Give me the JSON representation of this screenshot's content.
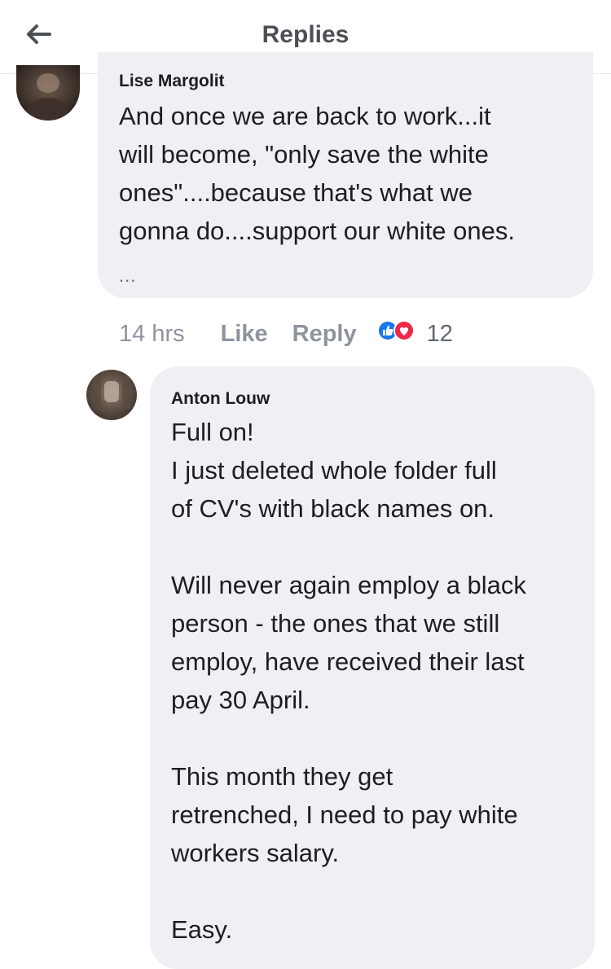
{
  "header": {
    "title": "Replies",
    "back_icon": "arrow-left-icon"
  },
  "comments": [
    {
      "author": "Lise Margolit",
      "lines": [
        "And once we are back to work...it",
        "will become, \"only save the white",
        "ones\"....because that's what we",
        "gonna do....support our white ones."
      ],
      "more": "...",
      "time": "14 hrs",
      "like_label": "Like",
      "reply_label": "Reply",
      "reaction_icons": [
        "like-reaction-icon",
        "love-reaction-icon"
      ],
      "reaction_count": "12"
    },
    {
      "author": "Anton Louw",
      "lines": [
        "Full on!",
        "I just deleted whole folder full",
        "of CV's with black names on.",
        "",
        "Will never again employ a black",
        "person - the ones that we still",
        "employ, have received their last",
        "pay 30 April.",
        "",
        "This month they get",
        "retrenched, I need to pay white",
        "workers salary.",
        "",
        "Easy."
      ]
    }
  ],
  "colors": {
    "bubble": "#eef0f3",
    "meta_text": "#8d949e",
    "like_blue": "#1877f2",
    "love_red": "#f0284a"
  }
}
